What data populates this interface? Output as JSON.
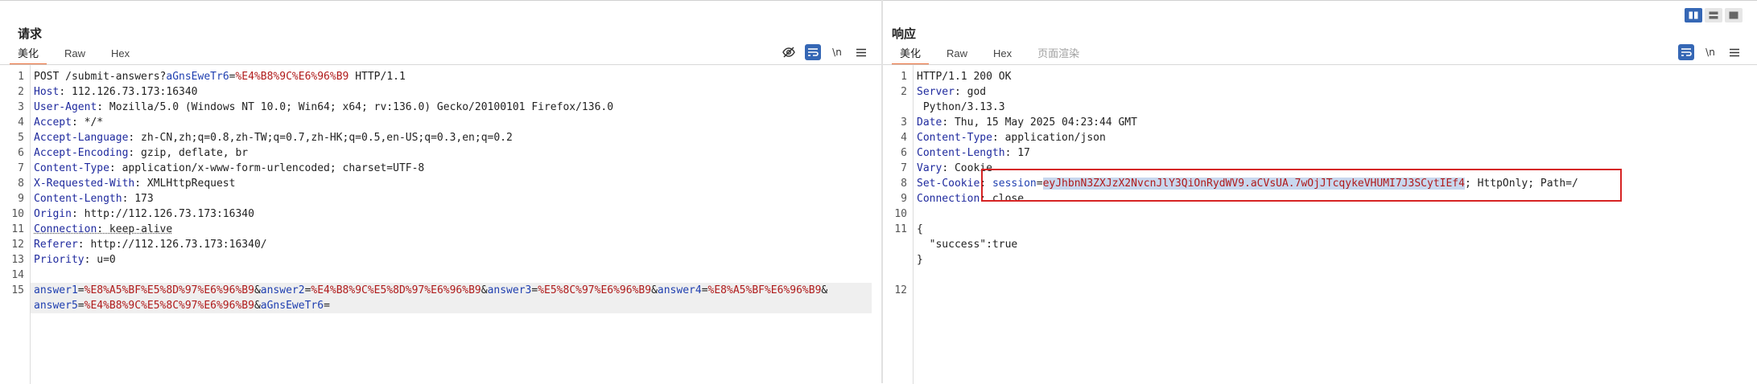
{
  "request": {
    "title": "请求",
    "tabs": [
      {
        "label": "美化",
        "active": true
      },
      {
        "label": "Raw",
        "active": false
      },
      {
        "label": "Hex",
        "active": false
      }
    ],
    "tools": {
      "hide_icon": "eye-slash-icon",
      "wrap_icon": "wrap-lines-icon",
      "newline_label": "\\n",
      "menu_icon": "hamburger-menu-icon"
    },
    "lines": [
      {
        "n": "1",
        "seg": [
          {
            "t": "POST /submit-answers?"
          },
          {
            "t": "aGnsEweTr6",
            "c": "pk"
          },
          {
            "t": "="
          },
          {
            "t": "%E4%B8%9C%E6%96%B9",
            "c": "pv"
          },
          {
            "t": " HTTP/1.1"
          }
        ]
      },
      {
        "n": "2",
        "seg": [
          {
            "t": "Host",
            "c": "hk"
          },
          {
            "t": ": 112.126.73.173:16340"
          }
        ]
      },
      {
        "n": "3",
        "seg": [
          {
            "t": "User-Agent",
            "c": "hk"
          },
          {
            "t": ": Mozilla/5.0 (Windows NT 10.0; Win64; x64; rv:136.0) Gecko/20100101 Firefox/136.0"
          }
        ]
      },
      {
        "n": "4",
        "seg": [
          {
            "t": "Accept",
            "c": "hk"
          },
          {
            "t": ": */*"
          }
        ]
      },
      {
        "n": "5",
        "seg": [
          {
            "t": "Accept-Language",
            "c": "hk"
          },
          {
            "t": ": zh-CN,zh;q=0.8,zh-TW;q=0.7,zh-HK;q=0.5,en-US;q=0.3,en;q=0.2"
          }
        ]
      },
      {
        "n": "6",
        "seg": [
          {
            "t": "Accept-Encoding",
            "c": "hk"
          },
          {
            "t": ": gzip, deflate, br"
          }
        ]
      },
      {
        "n": "7",
        "seg": [
          {
            "t": "Content-Type",
            "c": "hk"
          },
          {
            "t": ": application/x-www-form-urlencoded; charset=UTF-8"
          }
        ]
      },
      {
        "n": "8",
        "seg": [
          {
            "t": "X-Requested-With",
            "c": "hk"
          },
          {
            "t": ": XMLHttpRequest"
          }
        ]
      },
      {
        "n": "9",
        "seg": [
          {
            "t": "Content-Length",
            "c": "hk"
          },
          {
            "t": ": 173"
          }
        ]
      },
      {
        "n": "10",
        "seg": [
          {
            "t": "Origin",
            "c": "hk"
          },
          {
            "t": ": http://112.126.73.173:16340"
          }
        ]
      },
      {
        "n": "11",
        "seg": [
          {
            "t": "Connection",
            "c": "hk dotted"
          },
          {
            "t": ": keep-alive",
            "c": "dotted"
          }
        ]
      },
      {
        "n": "12",
        "seg": [
          {
            "t": "Referer",
            "c": "hk"
          },
          {
            "t": ": http://112.126.73.173:16340/"
          }
        ]
      },
      {
        "n": "13",
        "seg": [
          {
            "t": "Priority",
            "c": "hk"
          },
          {
            "t": ": u=0"
          }
        ]
      },
      {
        "n": "14",
        "seg": []
      },
      {
        "n": "15",
        "hl": true,
        "seg": [
          {
            "t": "answer1",
            "c": "pk"
          },
          {
            "t": "="
          },
          {
            "t": "%E8%A5%BF%E5%8D%97%E6%96%B9",
            "c": "pv"
          },
          {
            "t": "&"
          },
          {
            "t": "answer2",
            "c": "pk"
          },
          {
            "t": "="
          },
          {
            "t": "%E4%B8%9C%E5%8D%97%E6%96%B9",
            "c": "pv"
          },
          {
            "t": "&"
          },
          {
            "t": "answer3",
            "c": "pk"
          },
          {
            "t": "="
          },
          {
            "t": "%E5%8C%97%E6%96%B9",
            "c": "pv"
          },
          {
            "t": "&"
          },
          {
            "t": "answer4",
            "c": "pk"
          },
          {
            "t": "="
          },
          {
            "t": "%E8%A5%BF%E6%96%B9",
            "c": "pv"
          },
          {
            "t": "&"
          }
        ]
      },
      {
        "n": "",
        "hl": true,
        "seg": [
          {
            "t": "answer5",
            "c": "pk"
          },
          {
            "t": "="
          },
          {
            "t": "%E4%B8%9C%E5%8C%97%E6%96%B9",
            "c": "pv"
          },
          {
            "t": "&"
          },
          {
            "t": "aGnsEweTr6",
            "c": "pk"
          },
          {
            "t": "="
          }
        ]
      }
    ]
  },
  "response": {
    "title": "响应",
    "tabs": [
      {
        "label": "美化",
        "active": true
      },
      {
        "label": "Raw",
        "active": false
      },
      {
        "label": "Hex",
        "active": false
      },
      {
        "label": "页面渲染",
        "active": false,
        "disabled": true
      }
    ],
    "tools": {
      "wrap_icon": "wrap-lines-icon",
      "newline_label": "\\n",
      "menu_icon": "hamburger-menu-icon"
    },
    "lines": [
      {
        "n": "1",
        "seg": [
          {
            "t": "HTTP/1.1 200 OK"
          }
        ]
      },
      {
        "n": "2",
        "seg": [
          {
            "t": "Server",
            "c": "hk"
          },
          {
            "t": ": god"
          }
        ]
      },
      {
        "n": "",
        "seg": [
          {
            "t": " Python/3.13.3"
          }
        ]
      },
      {
        "n": "3",
        "seg": [
          {
            "t": "Date",
            "c": "hk"
          },
          {
            "t": ": Thu, 15 May 2025 04:23:44 GMT"
          }
        ]
      },
      {
        "n": "4",
        "seg": [
          {
            "t": "Content-Type",
            "c": "hk"
          },
          {
            "t": ": application/json"
          }
        ]
      },
      {
        "n": "6",
        "seg": [
          {
            "t": "Content-Length",
            "c": "hk"
          },
          {
            "t": ": 17"
          }
        ]
      },
      {
        "n": "7",
        "seg": [
          {
            "t": "Vary",
            "c": "hk"
          },
          {
            "t": ": Cookie"
          }
        ]
      },
      {
        "n": "8",
        "seg": [
          {
            "t": "Set-Cookie",
            "c": "hk"
          },
          {
            "t": ": "
          },
          {
            "t": "session",
            "c": "pk"
          },
          {
            "t": "="
          },
          {
            "t": "eyJhbnN3ZXJzX2NvcnJlY3QiOnRydWV9.aCVsUA.7wOjJTcqykeVHUMI7J3SCytIEf4",
            "c": "pv sel"
          },
          {
            "t": "; HttpOnly; Path=/"
          }
        ]
      },
      {
        "n": "9",
        "seg": [
          {
            "t": "Connection",
            "c": "hk"
          },
          {
            "t": ": close"
          }
        ]
      },
      {
        "n": "10",
        "seg": []
      },
      {
        "n": "11",
        "seg": [
          {
            "t": "{"
          }
        ]
      },
      {
        "n": "",
        "seg": [
          {
            "t": "  \"success\":true"
          }
        ]
      },
      {
        "n": "",
        "seg": [
          {
            "t": "}"
          }
        ]
      },
      {
        "n": "",
        "seg": []
      },
      {
        "n": "12",
        "seg": []
      }
    ]
  },
  "layout_buttons": [
    "split-horizontal-icon",
    "split-vertical-icon",
    "tabs-view-icon"
  ]
}
